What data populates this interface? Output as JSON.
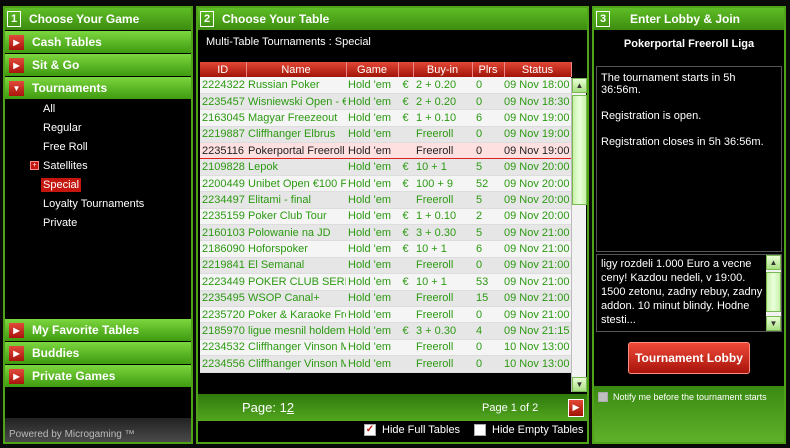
{
  "panel1": {
    "number": "1",
    "title": "Choose Your Game",
    "categories": [
      {
        "label": "Cash Tables",
        "arrow": "▶"
      },
      {
        "label": "Sit & Go",
        "arrow": "▶"
      },
      {
        "label": "Tournaments",
        "arrow": "▼"
      }
    ],
    "subitems": [
      {
        "label": "All"
      },
      {
        "label": "Regular"
      },
      {
        "label": "Free Roll"
      },
      {
        "label": "Satellites",
        "expand": "+"
      },
      {
        "label": "Special",
        "active": true
      },
      {
        "label": "Loyalty Tournaments"
      },
      {
        "label": "Private"
      }
    ],
    "bottom_categories": [
      {
        "label": "My Favorite Tables",
        "arrow": "▶"
      },
      {
        "label": "Buddies",
        "arrow": "▶"
      },
      {
        "label": "Private Games",
        "arrow": "▶"
      }
    ],
    "powered_by": "Powered by Microgaming ™"
  },
  "panel2": {
    "number": "2",
    "title": "Choose Your Table",
    "subtitle": "Multi-Table Tournaments : Special",
    "columns": [
      "ID",
      "Name",
      "Game",
      "",
      "Buy-in",
      "Plrs",
      "Status"
    ],
    "rows": [
      [
        "2224322",
        "Russian Poker",
        "Hold 'em",
        "€",
        "2 + 0.20",
        "0",
        "09 Nov 18:00"
      ],
      [
        "2235457",
        "Wisniewski Open - €",
        "Hold 'em",
        "€",
        "2 + 0.20",
        "0",
        "09 Nov 18:30"
      ],
      [
        "2163045",
        "Magyar Freezeout",
        "Hold 'em",
        "€",
        "1 + 0.10",
        "6",
        "09 Nov 19:00"
      ],
      [
        "2219887",
        "Cliffhanger Elbrus",
        "Hold 'em",
        "",
        "Freeroll",
        "0",
        "09 Nov 19:00"
      ],
      [
        "2235116",
        "Pokerportal Freeroll L",
        "Hold 'em",
        "",
        "Freeroll",
        "0",
        "09 Nov 19:00"
      ],
      [
        "2109828",
        "Lepok",
        "Hold 'em",
        "€",
        "10 + 1",
        "5",
        "09 Nov 20:00"
      ],
      [
        "2200449",
        "Unibet Open €100 Fi",
        "Hold 'em",
        "€",
        "100 + 9",
        "52",
        "09 Nov 20:00"
      ],
      [
        "2234497",
        "Elitami - final",
        "Hold 'em",
        "",
        "Freeroll",
        "5",
        "09 Nov 20:00"
      ],
      [
        "2235159",
        "Poker Club Tour",
        "Hold 'em",
        "€",
        "1 + 0.10",
        "2",
        "09 Nov 20:00"
      ],
      [
        "2160103",
        "Polowanie na JD",
        "Hold 'em",
        "€",
        "3 + 0.30",
        "5",
        "09 Nov 21:00"
      ],
      [
        "2186090",
        "Hoforspoker",
        "Hold 'em",
        "€",
        "10 + 1",
        "6",
        "09 Nov 21:00"
      ],
      [
        "2219841",
        "El Semanal",
        "Hold 'em",
        "",
        "Freeroll",
        "0",
        "09 Nov 21:00"
      ],
      [
        "2223449",
        "POKER CLUB SERII",
        "Hold 'em",
        "€",
        "10 + 1",
        "53",
        "09 Nov 21:00"
      ],
      [
        "2235495",
        "WSOP Canal+",
        "Hold 'em",
        "",
        "Freeroll",
        "15",
        "09 Nov 21:00"
      ],
      [
        "2235720",
        "Poker & Karaoke Fre",
        "Hold 'em",
        "",
        "Freeroll",
        "0",
        "09 Nov 21:00"
      ],
      [
        "2185970",
        "ligue mesnil holdem",
        "Hold 'em",
        "€",
        "3 + 0.30",
        "4",
        "09 Nov 21:15"
      ],
      [
        "2234532",
        "Cliffhanger Vinson M",
        "Hold 'em",
        "",
        "Freeroll",
        "0",
        "10 Nov 13:00"
      ],
      [
        "2234556",
        "Cliffhanger Vinson M",
        "Hold 'em",
        "",
        "Freeroll",
        "0",
        "10 Nov 13:00"
      ]
    ],
    "selected_row": 4,
    "pager": {
      "label": "Page:",
      "page1": "1",
      "page2": "2",
      "info": "Page 1 of 2"
    },
    "hide_full": {
      "label": "Hide Full Tables",
      "checked": true
    },
    "hide_empty": {
      "label": "Hide Empty Tables",
      "checked": false
    }
  },
  "panel3": {
    "number": "3",
    "title": "Enter Lobby & Join",
    "lobby_title": "Pokerportal Freeroll Liga",
    "info": [
      "The tournament starts in 5h 36:56m.",
      "Registration is open.",
      "Registration closes in 5h 36:56m."
    ],
    "description": "ligy rozdeli 1.000 Euro a vecne ceny! Kazdou nedeli, v 19:00. 1500 zetonu, zadny rebuy, zadny addon. 10 minut blindy. Hodne stesti...",
    "lobby_button": "Tournament Lobby",
    "notify_label": "Notify me before the tournament starts"
  },
  "colors": {
    "accent_green": "#4fa317",
    "accent_red": "#c4150f",
    "text_green": "#2c9a12"
  }
}
